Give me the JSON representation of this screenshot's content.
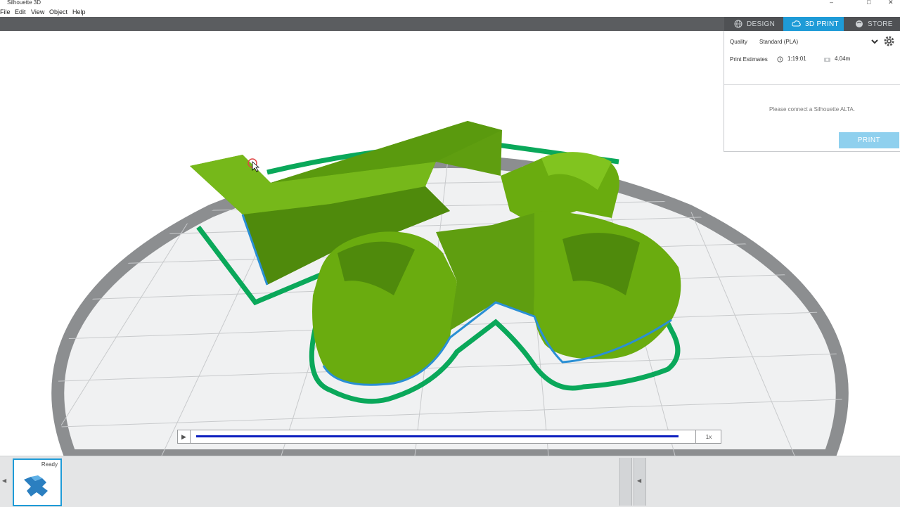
{
  "window": {
    "title": "Silhouette 3D",
    "controls": {
      "minimize": "–",
      "maximize": "□",
      "close": "✕"
    }
  },
  "menu": [
    "File",
    "Edit",
    "View",
    "Object",
    "Help"
  ],
  "tabs": [
    {
      "label": "DESIGN",
      "icon": "globe-icon",
      "active": false
    },
    {
      "label": "3D PRINT",
      "icon": "print-cloud-icon",
      "active": true
    },
    {
      "label": "STORE",
      "icon": "store-icon",
      "active": false
    }
  ],
  "panel": {
    "quality_label": "Quality",
    "quality_value": "Standard (PLA)",
    "estimates_label": "Print Estimates",
    "time": "1:19:01",
    "filament": "4.04m",
    "message": "Please connect a Silhouette ALTA.",
    "print_label": "PRINT"
  },
  "playback": {
    "play_icon": "▶",
    "speed": "1x",
    "progress": 1.0
  },
  "thumbnail": {
    "status": "Ready"
  },
  "colors": {
    "accent": "#1e9bd7",
    "model_green": "#6aac0f",
    "outline_green": "#0aa85a",
    "track_blue": "#0d1fbf"
  }
}
